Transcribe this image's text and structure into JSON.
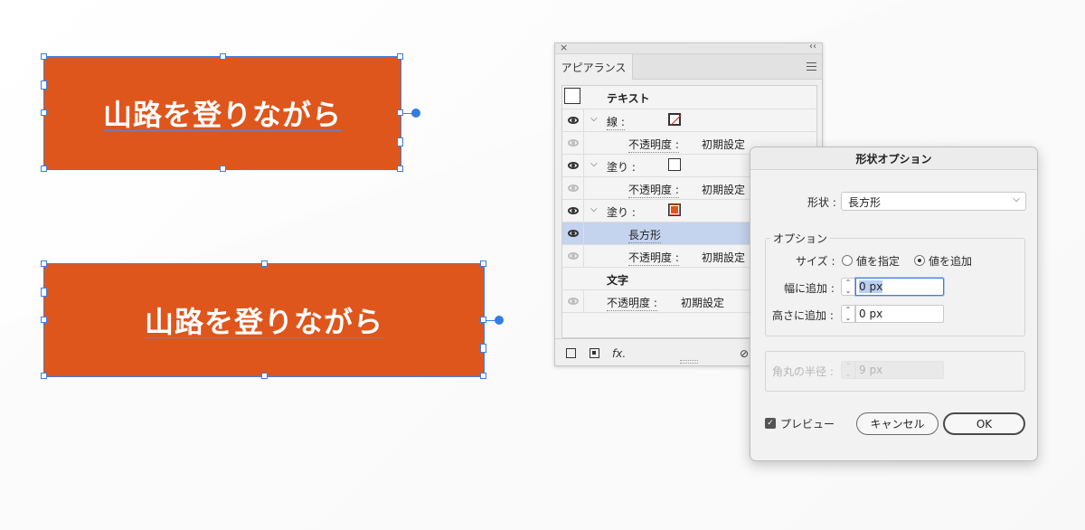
{
  "artboard": {
    "button_text_1": "山路を登りながら",
    "button_text_2": "山路を登りながら",
    "fill_color": "#df561c",
    "selection_color": "#3b7ee0"
  },
  "appearance_panel": {
    "close_icon": "×",
    "collapse_icon": "‹‹",
    "tab_label": "アピアランス",
    "rows": {
      "text_header": "テキスト",
      "stroke_label": "線 :",
      "opacity1_label": "不透明度 :",
      "opacity1_value": "初期設定",
      "fill1_label": "塗り :",
      "opacity2_label": "不透明度 :",
      "opacity2_value": "初期設定",
      "fill2_label": "塗り :",
      "effect_label": "長方形",
      "opacity3_label": "不透明度 :",
      "opacity3_value": "初期設定",
      "chars_label": "文字",
      "opacity4_label": "不透明度 :",
      "opacity4_value": "初期設定"
    },
    "footer_fx": "fx."
  },
  "shape_dialog": {
    "title": "形状オプション",
    "shape_label": "形状 :",
    "shape_value": "長方形",
    "options_legend": "オプション",
    "size_label": "サイズ :",
    "radio_specify": "値を指定",
    "radio_add": "値を追加",
    "width_label": "幅に追加 :",
    "width_value": "0 px",
    "height_label": "高さに追加 :",
    "height_value": "0 px",
    "corner_label": "角丸の半径 :",
    "corner_value": "9 px",
    "preview_label": "プレビュー",
    "cancel_label": "キャンセル",
    "ok_label": "OK"
  }
}
